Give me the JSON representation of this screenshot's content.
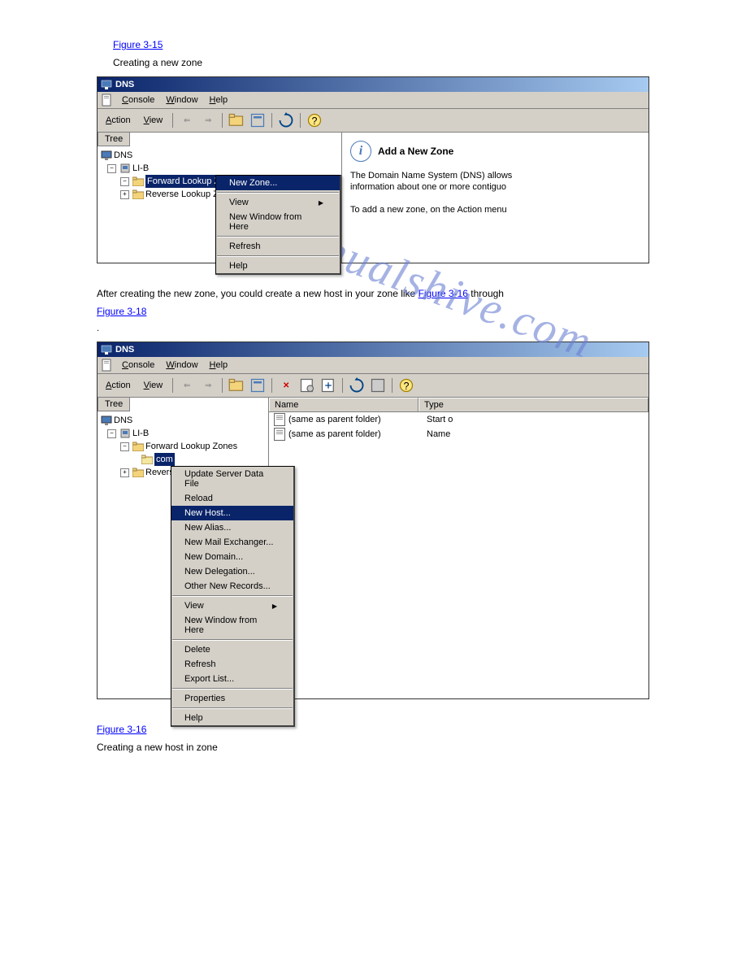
{
  "page": {
    "instructions": {
      "line1a": "Figure 3-15",
      "line1b": " Creating a new zone",
      "line2a": "After creating the new zone, you could create a new host in your zone like ",
      "line2b": "Figure 3-16",
      "line2c": " through ",
      "line3a": "Figure 3-18",
      "line4a": "Figure 3-16",
      "line4b": " Creating a new host in zone",
      "line5": ". "
    },
    "watermark": "manualshive.com"
  },
  "screenshot1": {
    "title": "DNS",
    "menubar": {
      "console": "Console",
      "window": "Window",
      "help": "Help"
    },
    "toolbar": {
      "action": "Action",
      "view": "View"
    },
    "tree_tab": "Tree",
    "tree": {
      "root": "DNS",
      "server": "LI-B",
      "fwd": "Forward Lookup Zones",
      "rev": "Reverse Lookup Zone"
    },
    "context_menu": {
      "new_zone": "New Zone...",
      "view": "View",
      "new_window": "New Window from Here",
      "refresh": "Refresh",
      "help": "Help"
    },
    "right_pane": {
      "heading": "Add a New Zone",
      "p1": "The Domain Name System (DNS) allows",
      "p2": "information about one or more contiguo",
      "p3": "To add a new zone, on the Action menu"
    }
  },
  "screenshot2": {
    "title": "DNS",
    "menubar": {
      "console": "Console",
      "window": "Window",
      "help": "Help"
    },
    "toolbar": {
      "action": "Action",
      "view": "View"
    },
    "tree_tab": "Tree",
    "tree": {
      "root": "DNS",
      "server": "LI-B",
      "fwd": "Forward Lookup Zones",
      "com": "com",
      "rev": "Revers"
    },
    "list": {
      "col_name": "Name",
      "col_type": "Type",
      "row1_name": "(same as parent folder)",
      "row1_type": "Start o",
      "row2_name": "(same as parent folder)",
      "row2_type": "Name "
    },
    "context_menu": {
      "update": "Update Server Data File",
      "reload": "Reload",
      "new_host": "New Host...",
      "new_alias": "New Alias...",
      "new_mx": "New Mail Exchanger...",
      "new_domain": "New Domain...",
      "new_delegation": "New Delegation...",
      "other": "Other New Records...",
      "view": "View",
      "new_window": "New Window from Here",
      "delete": "Delete",
      "refresh": "Refresh",
      "export": "Export List...",
      "properties": "Properties",
      "help": "Help"
    }
  }
}
